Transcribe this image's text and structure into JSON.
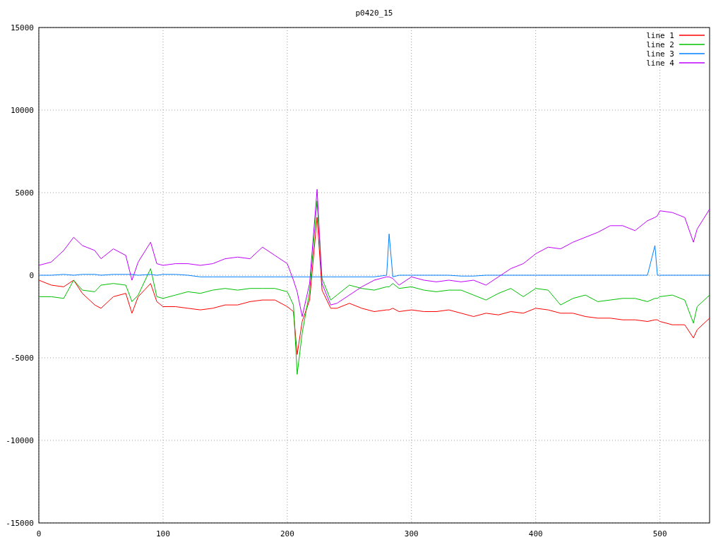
{
  "chart_data": {
    "type": "line",
    "title": "p0420_15",
    "xlim": [
      0,
      540
    ],
    "ylim": [
      -15000,
      15000
    ],
    "grid": true,
    "legend": true,
    "xticks": [
      0,
      100,
      200,
      300,
      400,
      500
    ],
    "yticks": [
      -15000,
      -10000,
      -5000,
      0,
      5000,
      10000,
      15000
    ],
    "x": [
      0,
      10,
      20,
      28,
      35,
      45,
      50,
      60,
      70,
      75,
      80,
      90,
      95,
      100,
      110,
      120,
      130,
      140,
      150,
      160,
      170,
      180,
      190,
      200,
      205,
      208,
      212,
      218,
      224,
      228,
      235,
      240,
      250,
      260,
      270,
      280,
      282,
      285,
      290,
      300,
      310,
      320,
      330,
      340,
      350,
      360,
      370,
      380,
      390,
      400,
      410,
      420,
      430,
      440,
      450,
      460,
      470,
      480,
      490,
      496,
      498,
      500,
      510,
      520,
      527,
      530,
      540
    ],
    "series": [
      {
        "name": "line 1",
        "color": "#ff0000",
        "values": [
          -300,
          -600,
          -700,
          -300,
          -1100,
          -1800,
          -2000,
          -1300,
          -1100,
          -2300,
          -1300,
          -500,
          -1600,
          -1900,
          -1900,
          -2000,
          -2100,
          -2000,
          -1800,
          -1800,
          -1600,
          -1500,
          -1500,
          -1900,
          -2200,
          -4800,
          -2800,
          -1500,
          3500,
          -900,
          -2000,
          -2000,
          -1700,
          -2000,
          -2200,
          -2100,
          -2100,
          -2000,
          -2200,
          -2100,
          -2200,
          -2200,
          -2100,
          -2300,
          -2500,
          -2300,
          -2400,
          -2200,
          -2300,
          -2000,
          -2100,
          -2300,
          -2300,
          -2500,
          -2600,
          -2600,
          -2700,
          -2700,
          -2800,
          -2700,
          -2700,
          -2800,
          -3000,
          -3000,
          -3800,
          -3300,
          -2600
        ]
      },
      {
        "name": "line 2",
        "color": "#00c000",
        "values": [
          -1300,
          -1300,
          -1400,
          -300,
          -900,
          -1000,
          -600,
          -500,
          -600,
          -1600,
          -1200,
          400,
          -1300,
          -1400,
          -1200,
          -1000,
          -1100,
          -900,
          -800,
          -900,
          -800,
          -800,
          -800,
          -1000,
          -1800,
          -6000,
          -3500,
          -1000,
          4500,
          -200,
          -1500,
          -1200,
          -600,
          -800,
          -900,
          -700,
          -700,
          -500,
          -800,
          -700,
          -900,
          -1000,
          -900,
          -900,
          -1200,
          -1500,
          -1100,
          -800,
          -1300,
          -800,
          -900,
          -1800,
          -1400,
          -1200,
          -1600,
          -1500,
          -1400,
          -1400,
          -1600,
          -1400,
          -1400,
          -1300,
          -1200,
          -1500,
          -2900,
          -1900,
          -1200
        ]
      },
      {
        "name": "line 3",
        "color": "#0080ff",
        "values": [
          0,
          0,
          50,
          0,
          50,
          50,
          0,
          50,
          50,
          50,
          0,
          50,
          0,
          50,
          50,
          0,
          -100,
          -100,
          -100,
          -100,
          -100,
          -100,
          -100,
          -100,
          -100,
          -100,
          -100,
          -100,
          -100,
          -100,
          -100,
          -100,
          -100,
          -100,
          -100,
          0,
          2500,
          -100,
          0,
          0,
          0,
          0,
          0,
          -50,
          -50,
          0,
          0,
          0,
          0,
          0,
          0,
          0,
          0,
          0,
          0,
          0,
          0,
          0,
          0,
          1800,
          0,
          0,
          0,
          0,
          0,
          0,
          0
        ]
      },
      {
        "name": "line 4",
        "color": "#c000ff",
        "values": [
          600,
          800,
          1500,
          2300,
          1800,
          1500,
          1000,
          1600,
          1200,
          -300,
          800,
          2000,
          700,
          600,
          700,
          700,
          600,
          700,
          1000,
          1100,
          1000,
          1700,
          1200,
          700,
          -300,
          -1000,
          -2500,
          -500,
          5200,
          -500,
          -1800,
          -1700,
          -1200,
          -700,
          -300,
          -100,
          -100,
          -200,
          -600,
          -100,
          -300,
          -400,
          -300,
          -400,
          -300,
          -600,
          -100,
          400,
          700,
          1300,
          1700,
          1600,
          2000,
          2300,
          2600,
          3000,
          3000,
          2700,
          3300,
          3500,
          3600,
          3900,
          3800,
          3500,
          2000,
          2800,
          4000
        ]
      }
    ]
  }
}
